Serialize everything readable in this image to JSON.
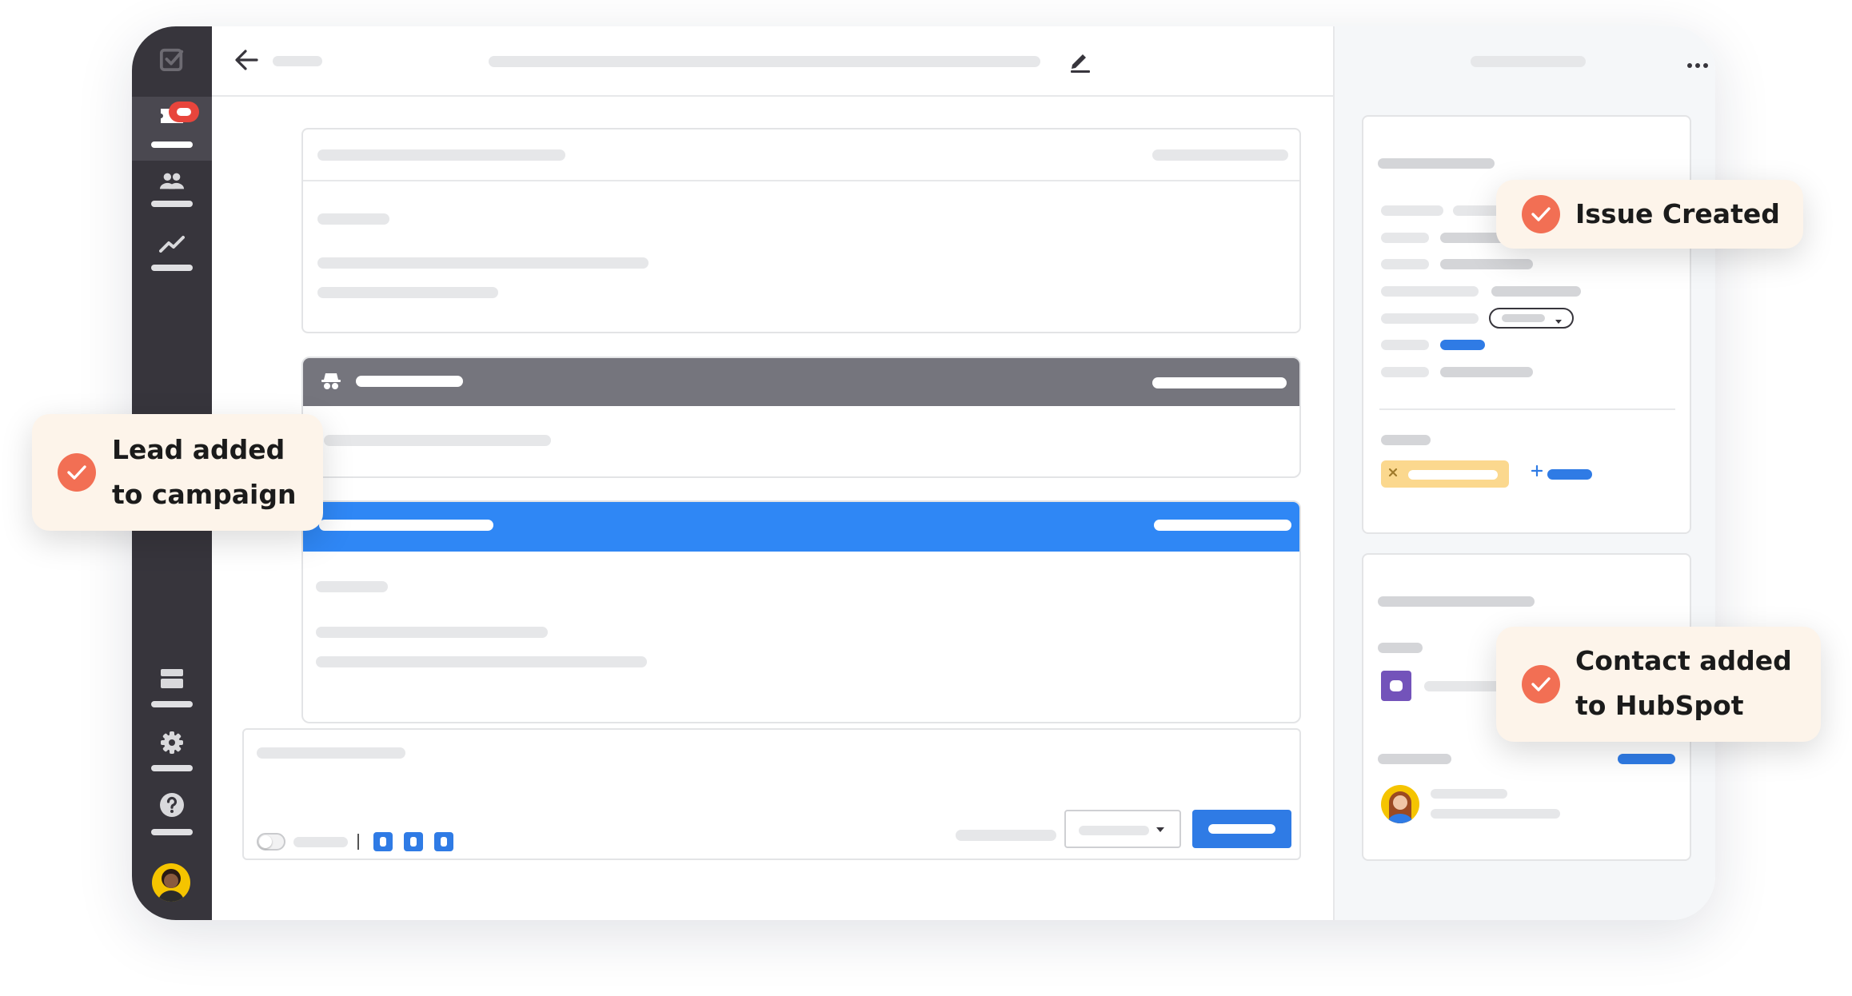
{
  "toasts": {
    "issue_created": "Issue Created",
    "lead_added": "Lead added\nto campaign",
    "contact_added": "Contact added\nto HubSpot"
  },
  "icons": {
    "logo": "check-square-icon",
    "tickets": "ticket-icon",
    "contacts": "users-icon",
    "reports": "chart-icon",
    "inbox": "inbox-icon",
    "settings": "gear-icon",
    "help": "help-icon",
    "back": "arrow-left-icon",
    "edit": "pencil-icon",
    "more": "more-horizontal-icon",
    "incognito": "incognito-icon"
  },
  "colors": {
    "accent": "#2f7be5",
    "sidebar": "#37353c",
    "toast_bg": "#fdf4ea",
    "check": "#f26f54",
    "badge": "#e8453c",
    "tag": "#fbd88e",
    "avatar_bg": "#f5c400",
    "integration": "#7353ba"
  }
}
